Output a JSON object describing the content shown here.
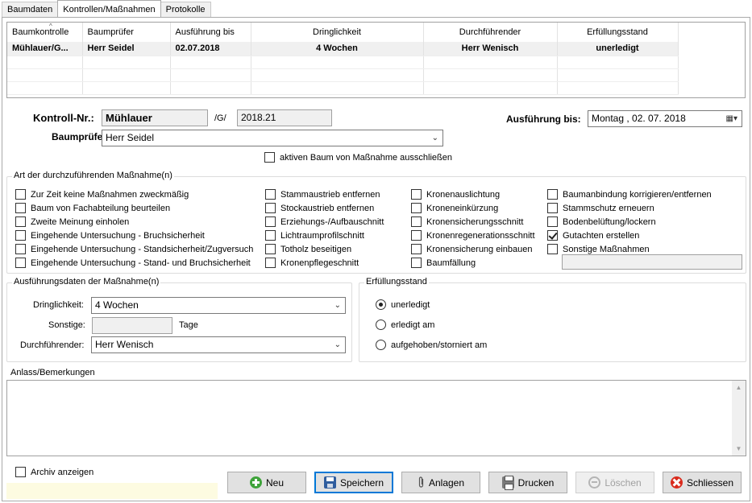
{
  "tabs": [
    "Baumdaten",
    "Kontrollen/Maßnahmen",
    "Protokolle"
  ],
  "grid": {
    "columns": [
      "Baumkontrolle",
      "Baumprüfer",
      "Ausführung bis",
      "Dringlichkeit",
      "Durchführender",
      "Erfüllungsstand"
    ],
    "rows": [
      [
        "Mühlauer/G...",
        "Herr Seidel",
        "02.07.2018",
        "4 Wochen",
        "Herr Wenisch",
        "unerledigt"
      ]
    ]
  },
  "kontroll_nr_label": "Kontroll-Nr.:",
  "kontroll_nr_value": "Mühlauer",
  "kontroll_sep": "/G/",
  "kontroll_suffix": "2018.21",
  "ausfuehrung_label": "Ausführung bis:",
  "ausfuehrung_date": "Montag   , 02. 07. 2018",
  "baumpruefer_label": "Baumprüfer:",
  "baumpruefer_value": "Herr Seidel",
  "exclude_checkbox": "aktiven Baum von Maßnahme ausschließen",
  "measures_group": {
    "title": "Art der durchzuführenden Maßnahme(n)",
    "col1": [
      "Zur Zeit keine Maßnahmen zweckmäßig",
      "Baum von Fachabteilung beurteilen",
      "Zweite Meinung einholen",
      "Eingehende Untersuchung - Bruchsicherheit",
      "Eingehende Untersuchung - Standsicherheit/Zugversuch",
      "Eingehende Untersuchung - Stand- und Bruchsicherheit"
    ],
    "col2": [
      "Stammaustrieb entfernen",
      "Stockaustrieb entfernen",
      "Erziehungs-/Aufbauschnitt",
      "Lichtraumprofilschnitt",
      "Totholz beseitigen",
      "Kronenpflegeschnitt"
    ],
    "col3": [
      "Kronenauslichtung",
      "Kroneneinkürzung",
      "Kronensicherungsschnitt",
      "Kronenregenerationsschnitt",
      "Kronensicherung einbauen",
      "Baumfällung"
    ],
    "col4": [
      "Baumanbindung korrigieren/entfernen",
      "Stammschutz erneuern",
      "Bodenbelüftung/lockern",
      "Gutachten erstellen",
      "Sonstige Maßnahmen"
    ],
    "checked": "Gutachten erstellen"
  },
  "exec_group": {
    "title": "Ausführungsdaten der Maßnahme(n)",
    "dringlichkeit_label": "Dringlichkeit:",
    "dringlichkeit_value": "4 Wochen",
    "sonstige_label": "Sonstige:",
    "sonstige_value": "",
    "tage_label": "Tage",
    "durchfuehrender_label": "Durchführender:",
    "durchfuehrender_value": "Herr Wenisch"
  },
  "status_group": {
    "title": "Erfüllungsstand",
    "options": [
      "unerledigt",
      "erledigt am",
      "aufgehoben/storniert am"
    ],
    "selected": "unerledigt"
  },
  "anlass_label": "Anlass/Bemerkungen",
  "anlass_value": "",
  "archiv_label": "Archiv anzeigen",
  "buttons": {
    "neu": "Neu",
    "speichern": "Speichern",
    "anlagen": "Anlagen",
    "drucken": "Drucken",
    "loeschen": "Löschen",
    "schliessen": "Schliessen"
  },
  "icons": {
    "neu": "plus-circle-icon",
    "speichern": "floppy-disk-icon",
    "anlagen": "paperclip-icon",
    "drucken": "printer-icon",
    "loeschen": "minus-circle-icon",
    "schliessen": "close-circle-icon"
  }
}
